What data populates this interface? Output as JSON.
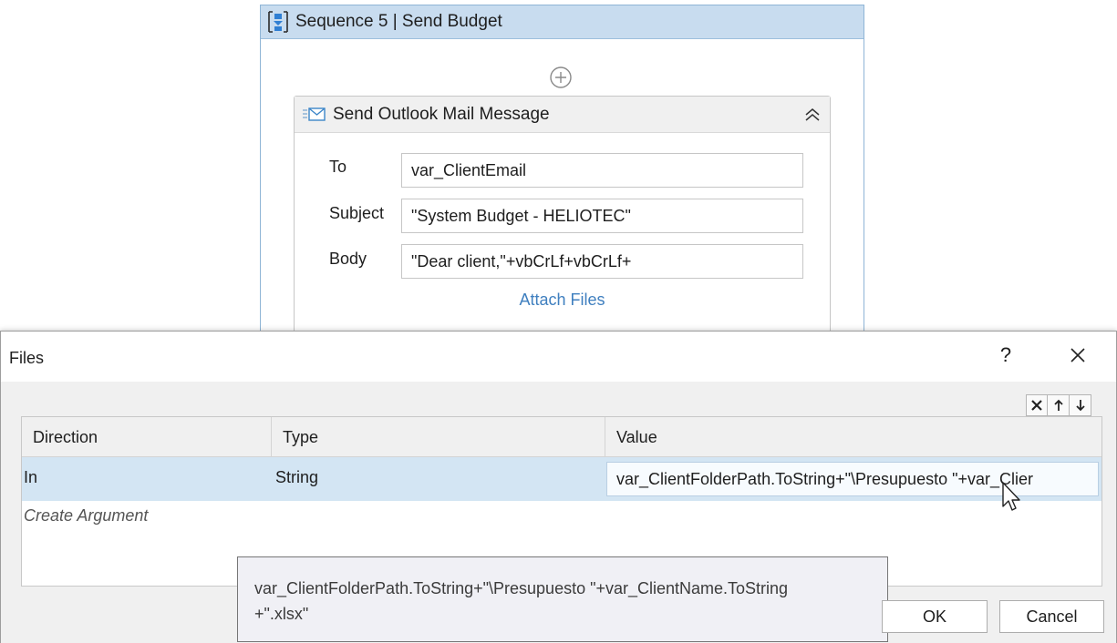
{
  "sequence": {
    "title": "Sequence 5 | Send Budget",
    "icon": "sequence-icon"
  },
  "activity": {
    "title": "Send Outlook Mail Message",
    "icon": "outlook-mail-icon",
    "fields": {
      "to_label": "To",
      "to_value": "var_ClientEmail",
      "subject_label": "Subject",
      "subject_value": "\"System Budget - HELIOTEC\"",
      "body_label": "Body",
      "body_value": "\"Dear client,\"+vbCrLf+vbCrLf+"
    },
    "attach_label": "Attach Files"
  },
  "dialog": {
    "title": "Files",
    "help_label": "?",
    "columns": [
      "Direction",
      "Type",
      "Value"
    ],
    "rows": [
      {
        "direction": "In",
        "type": "String",
        "value": "var_ClientFolderPath.ToString+\"\\Presupuesto \"+var_Clier"
      }
    ],
    "create_argument": "Create Argument",
    "tooltip_line1": "var_ClientFolderPath.ToString+\"\\Presupuesto \"+var_ClientName.ToString",
    "tooltip_line2": "+\".xlsx\"",
    "ok_label": "OK",
    "cancel_label": "Cancel"
  },
  "colors": {
    "sequence_header": "#c8dcef",
    "selected_row": "#d3e5f3",
    "link": "#3f7fbf",
    "dialog_body": "#f0f0f0"
  }
}
